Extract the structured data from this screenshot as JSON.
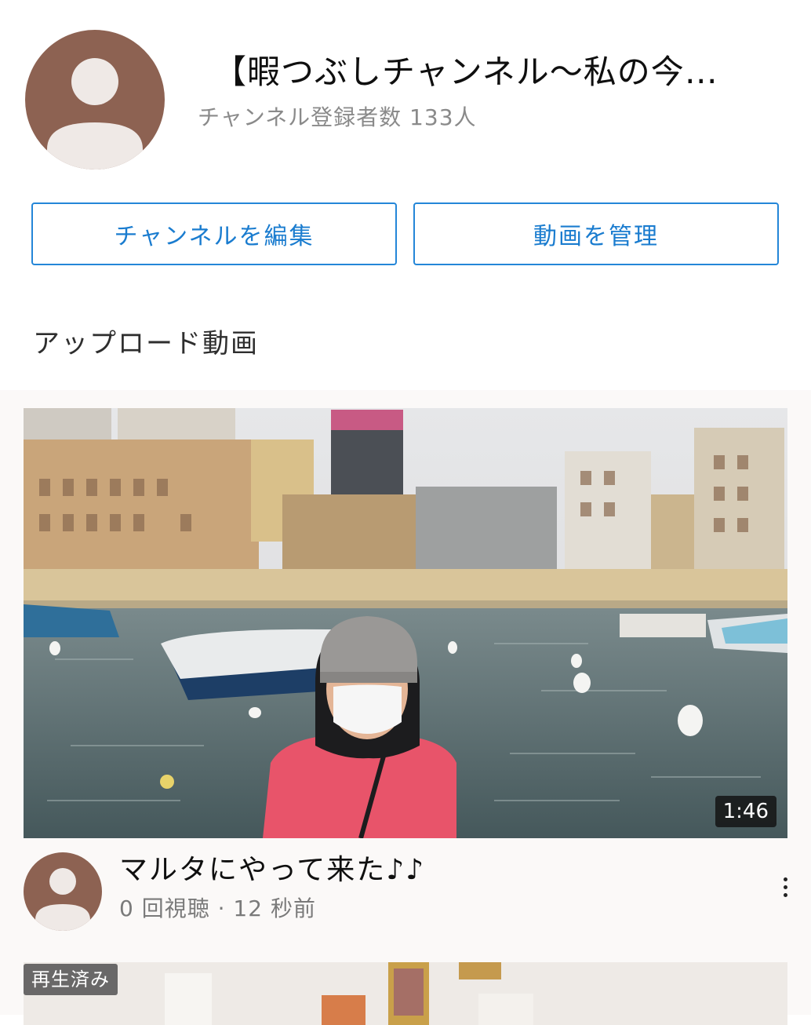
{
  "channel": {
    "title": "【暇つぶしチャンネル〜私の今…",
    "subscribers": "チャンネル登録者数 133人",
    "avatar_icon": "default-avatar-icon",
    "avatar_color": "#8d6252"
  },
  "actions": {
    "edit_label": "チャンネルを編集",
    "manage_label": "動画を管理"
  },
  "section": {
    "title": "アップロード動画"
  },
  "videos": [
    {
      "title": "マルタにやって来た♪♪",
      "meta": "0 回視聴 · 12 秒前",
      "duration": "1:46",
      "more_icon": "more-vert-icon"
    },
    {
      "badge": "再生済み"
    }
  ],
  "colors": {
    "accent": "#2486d8",
    "meta_text": "#7a7a7a"
  }
}
